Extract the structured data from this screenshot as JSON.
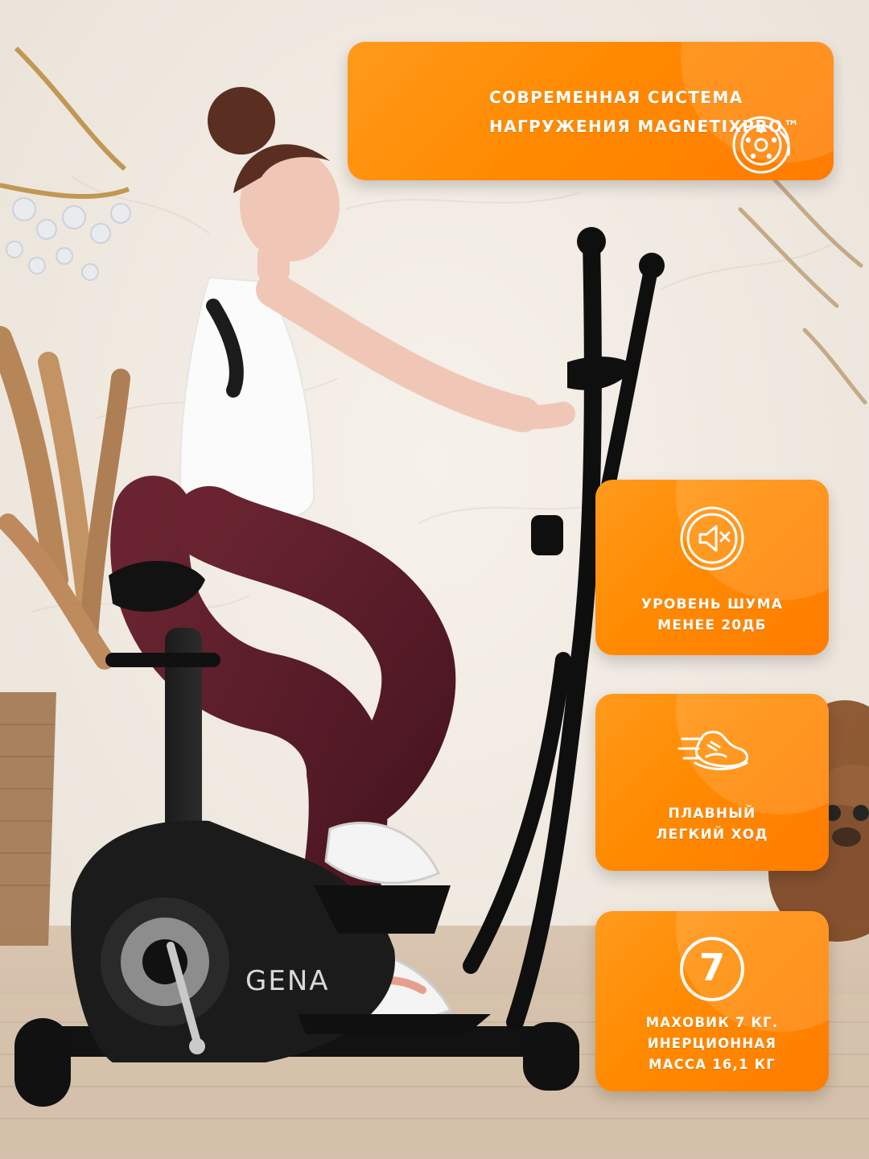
{
  "brand_visible_text": "GENA",
  "features": {
    "top": {
      "text": "СОВРЕМЕННАЯ СИСТЕМА\nНАГРУЖЕНИЯ MAGNETIXPRO™",
      "icon": "brake-disc-icon"
    },
    "noise": {
      "text": "УРОВЕНЬ ШУМА\nМЕНЕЕ 20ДБ",
      "icon": "speaker-mute-icon"
    },
    "smooth": {
      "text": "ПЛАВНЫЙ\nЛЕГКИЙ ХОД",
      "icon": "running-shoe-icon"
    },
    "flywheel": {
      "number": "7",
      "text": "МАХОВИК 7 КГ.\nИНЕРЦИОННАЯ\nМАССА 16,1 КГ",
      "icon": "number-circle-icon"
    }
  },
  "colors": {
    "accent": "#FF8A00",
    "text": "#FFFFFF"
  }
}
